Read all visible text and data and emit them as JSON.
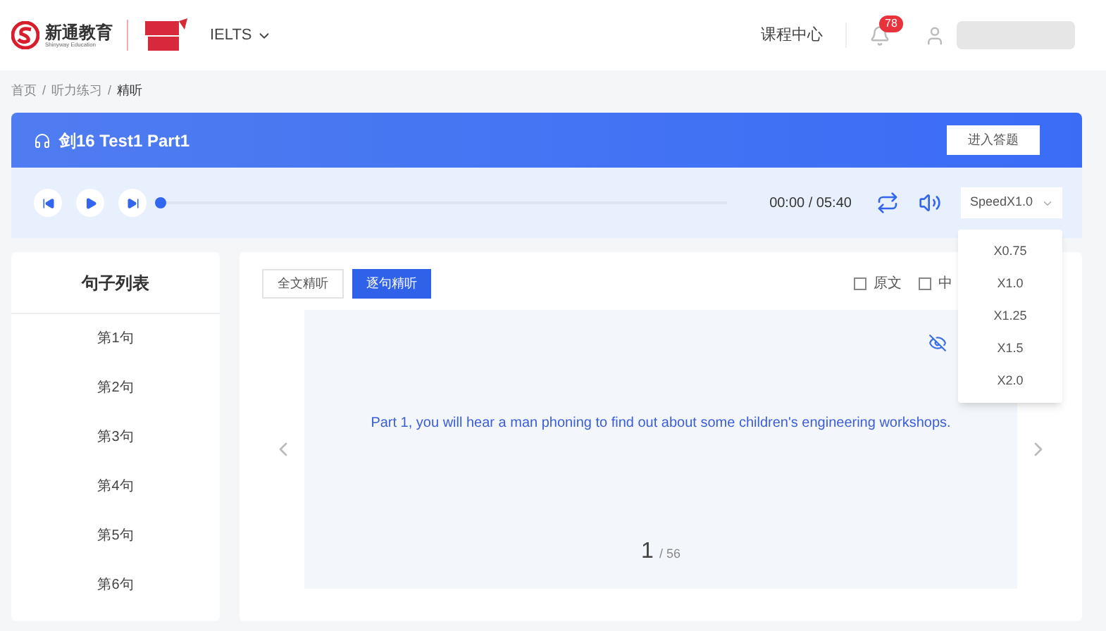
{
  "header": {
    "logo_name": "新通教育",
    "logo_subtitle": "Shinyway Education",
    "exam": "IELTS",
    "course_center": "课程中心",
    "notification_count": "78"
  },
  "breadcrumb": [
    {
      "label": "首页"
    },
    {
      "separator": "/",
      "label": "听力练习"
    },
    {
      "separator": "/",
      "label": "精听"
    }
  ],
  "lesson": {
    "title": "剑16 Test1 Part1",
    "answer_button": "进入答题"
  },
  "player": {
    "level": 0,
    "time": "00:00 / 05:40",
    "speed": "SpeedX1.0",
    "speed_options": [
      "X0.75",
      "X1.0",
      "X1.25",
      "X1.5",
      "X2.0"
    ]
  },
  "sentence_list": {
    "title": "句子列表",
    "items": [
      {
        "label": "第1句"
      },
      {
        "label": "第2句"
      },
      {
        "label": "第3句"
      },
      {
        "label": "第4句"
      },
      {
        "label": "第5句"
      },
      {
        "label": "第6句"
      }
    ]
  },
  "modes": [
    {
      "label": "全文精听",
      "selected": false
    },
    {
      "label": "逐句精听",
      "selected": true
    }
  ],
  "options": [
    {
      "label": "原文",
      "checked": false
    },
    {
      "label": "中",
      "checked": false
    }
  ],
  "sentence": {
    "text": "Part 1, you will hear a man phoning to find out about some children's engineering workshops.",
    "current": "1",
    "total": "/ 56"
  }
}
